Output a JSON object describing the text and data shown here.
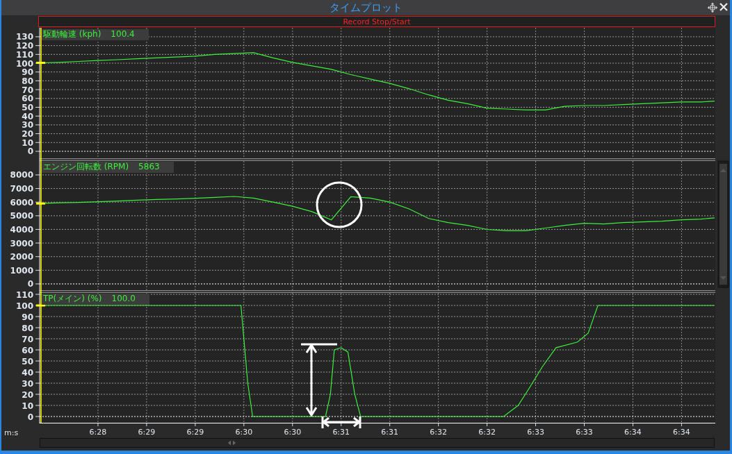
{
  "window": {
    "title": "タイムプロット"
  },
  "record_button": {
    "label": "Record Stop/Start"
  },
  "panels": [
    {
      "reading": "100.4",
      "scrollbar": false,
      "chart_data": {
        "type": "line",
        "x": [
          387.4,
          387.6,
          387.8,
          388.0,
          388.2,
          388.4,
          388.6,
          388.8,
          389.0,
          389.2,
          389.4,
          389.6,
          389.8,
          390.0,
          390.2,
          390.4,
          390.6,
          390.8,
          391.0,
          391.2,
          391.4,
          391.6,
          391.8,
          392.0,
          392.2,
          392.4,
          392.6,
          392.8,
          393.0,
          393.2,
          393.4,
          393.6,
          393.8,
          394.0,
          394.2,
          394.34
        ],
        "xlim": [
          387.4,
          394.34
        ],
        "ylim": [
          -7.9,
          140.2
        ],
        "grid": true,
        "ref_lines": [
          {
            "axis": "y",
            "value": 0
          }
        ],
        "yticks": [
          0,
          10,
          20,
          30,
          40,
          50,
          60,
          70,
          80,
          90,
          100,
          110,
          120,
          130
        ],
        "series": [
          {
            "name": "駆動輪速 (kph)",
            "color": "#3cf03c",
            "values": [
              100.4,
              101,
              102,
              103,
              104,
              105,
              106,
              107,
              108,
              110,
              111,
              112,
              106,
              101,
              97,
              93,
              87,
              82,
              77,
              71,
              64,
              58,
              54,
              49,
              48,
              47,
              47,
              51,
              52,
              52,
              53,
              54,
              55,
              56,
              56,
              57
            ]
          }
        ]
      }
    },
    {
      "reading": "5863",
      "scrollbar": true,
      "chart_data": {
        "type": "line",
        "x": [
          387.4,
          387.6,
          387.8,
          388.0,
          388.2,
          388.4,
          388.6,
          388.8,
          389.0,
          389.2,
          389.4,
          389.6,
          389.8,
          390.0,
          390.2,
          390.4,
          390.6,
          390.8,
          391.0,
          391.2,
          391.4,
          391.6,
          391.8,
          392.0,
          392.2,
          392.4,
          392.6,
          392.8,
          393.0,
          393.2,
          393.4,
          393.6,
          393.8,
          394.0,
          394.2,
          394.34
        ],
        "xlim": [
          387.4,
          394.34
        ],
        "ylim": [
          -460,
          9220
        ],
        "grid": true,
        "ref_lines": [
          {
            "axis": "y",
            "value": 0
          }
        ],
        "yticks": [
          0,
          1000,
          2000,
          3000,
          4000,
          5000,
          6000,
          7000,
          8000
        ],
        "series": [
          {
            "name": "エンジン回転数 (RPM)",
            "color": "#3cf03c",
            "values": [
              5900,
              5950,
              5980,
              6030,
              6080,
              6150,
              6200,
              6230,
              6280,
              6350,
              6420,
              6300,
              6000,
              5700,
              5300,
              4700,
              6400,
              6300,
              6000,
              5500,
              4800,
              4500,
              4300,
              4000,
              3900,
              3900,
              4100,
              4300,
              4450,
              4400,
              4500,
              4550,
              4600,
              4700,
              4750,
              4850
            ]
          }
        ]
      }
    },
    {
      "reading": "100.0",
      "scrollbar": false,
      "chart_data": {
        "type": "line",
        "xlabel": "m:s",
        "x": [
          387.4,
          389.47,
          389.54,
          389.59,
          390.34,
          390.39,
          390.43,
          390.5,
          390.57,
          390.64,
          390.7,
          392.17,
          392.32,
          392.43,
          392.57,
          392.71,
          392.93,
          393.04,
          393.14,
          394.34
        ],
        "xlim": [
          387.4,
          394.34
        ],
        "ylim": [
          -6.25,
          113.75
        ],
        "grid": true,
        "ref_lines": [
          {
            "axis": "y",
            "value": 0
          }
        ],
        "xticks": [
          {
            "value": 388,
            "label": "6:28"
          },
          {
            "value": 388.5,
            "label": "6:29"
          },
          {
            "value": 389,
            "label": "6:29"
          },
          {
            "value": 389.5,
            "label": "6:30"
          },
          {
            "value": 390,
            "label": "6:30"
          },
          {
            "value": 390.5,
            "label": "6:31"
          },
          {
            "value": 391,
            "label": "6:31"
          },
          {
            "value": 391.5,
            "label": "6:32"
          },
          {
            "value": 392,
            "label": "6:32"
          },
          {
            "value": 392.5,
            "label": "6:33"
          },
          {
            "value": 393,
            "label": "6:33"
          },
          {
            "value": 393.5,
            "label": "6:34"
          },
          {
            "value": 394,
            "label": "6:34"
          }
        ],
        "yticks": [
          0,
          10,
          20,
          30,
          40,
          50,
          60,
          70,
          80,
          90,
          100,
          110
        ],
        "series": [
          {
            "name": "TP(メイン) (%)",
            "color": "#3cf03c",
            "values": [
              100,
              100,
              30,
              0,
              0,
              20,
              60,
              62,
              58,
              20,
              0,
              0,
              10,
              25,
              45,
              62,
              67,
              75,
              100,
              100
            ]
          }
        ]
      }
    }
  ]
}
